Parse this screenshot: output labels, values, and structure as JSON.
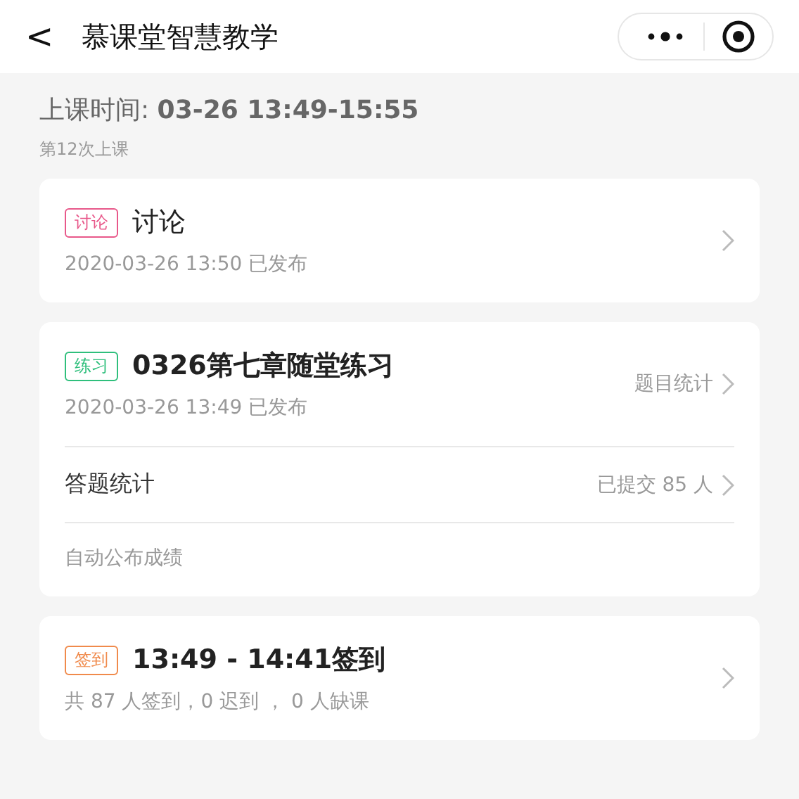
{
  "header": {
    "back": "<",
    "title": "慕课堂智慧教学"
  },
  "session": {
    "time": "上课时间: **03-26 13:49-15:55**",
    "count": "第12次上课"
  },
  "cards": [
    {
      "kind": "simple",
      "tag": "讨论",
      "color": "#e8588a",
      "title": "讨论",
      "bold": false,
      "sub": "2020-03-26 13:50 已发布"
    },
    {
      "kind": "exercise",
      "tag": "练习",
      "color": "#2fbf7c",
      "title": "0326第七章随堂练习",
      "bold": true,
      "sub": "2020-03-26 13:49 已发布",
      "side": "题目统计",
      "stat_label": "答题统计",
      "stat_value": "已提交 85 人",
      "note": "自动公布成绩"
    },
    {
      "kind": "simple",
      "tag": "签到",
      "color": "#f08a4b",
      "title": "13:49 - 14:41签到",
      "bold": true,
      "sub": "共 87 人签到，0 迟到 ， 0 人缺课"
    }
  ]
}
